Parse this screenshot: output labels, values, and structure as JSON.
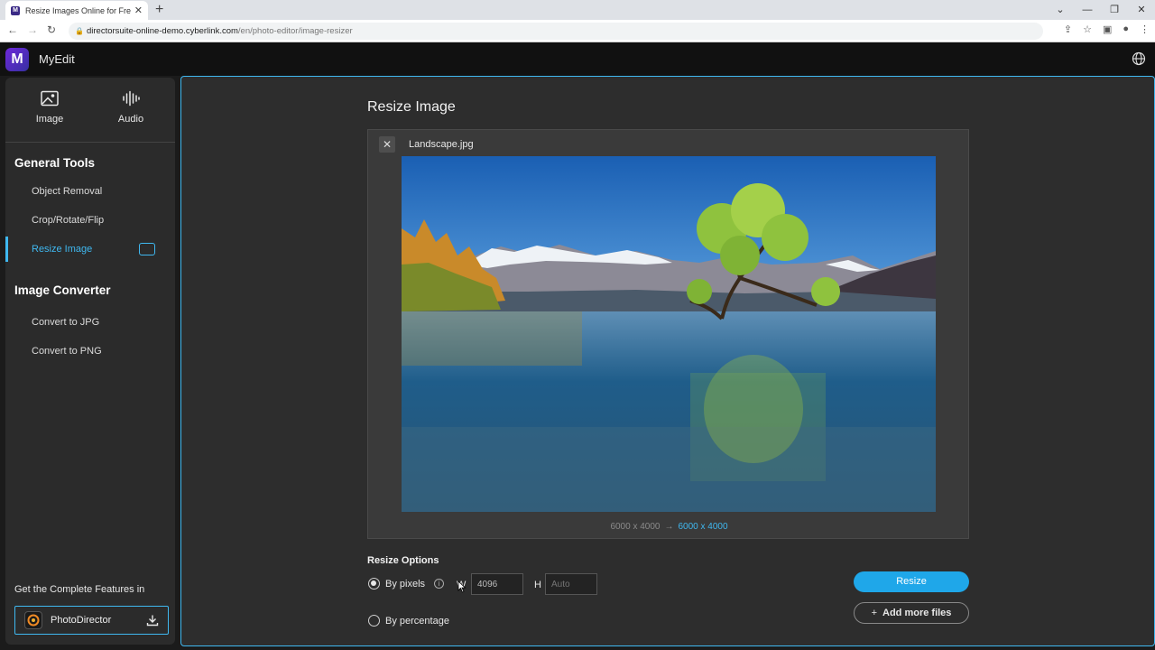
{
  "browser": {
    "tab_title": "Resize Images Online for Free - P",
    "tab_favicon_letter": "M",
    "url_host": "directorsuite-online-demo.cyberlink.com",
    "url_path": "/en/photo-editor/image-resizer"
  },
  "app": {
    "name": "MyEdit",
    "logo_letter": "M"
  },
  "sidebar": {
    "categories": [
      {
        "label": "Image",
        "icon": "image-icon"
      },
      {
        "label": "Audio",
        "icon": "audio-waveform-icon"
      }
    ],
    "sections": [
      {
        "heading": "General Tools",
        "items": [
          {
            "label": "Object Removal"
          },
          {
            "label": "Crop/Rotate/Flip"
          },
          {
            "label": "Resize Image",
            "active": true
          }
        ]
      },
      {
        "heading": "Image Converter",
        "items": [
          {
            "label": "Convert to JPG"
          },
          {
            "label": "Convert to PNG"
          }
        ]
      }
    ],
    "promo_text": "Get the Complete Features in",
    "promo_product": "PhotoDirector"
  },
  "main": {
    "title": "Resize Image",
    "file_name": "Landscape.jpg",
    "original_size": "6000 x 4000",
    "new_size": "6000 x 4000",
    "options_title": "Resize Options",
    "by_pixels_label": "By pixels",
    "by_percentage_label": "By percentage",
    "selected_option": "By pixels",
    "width_label": "W",
    "width_value": "4096",
    "height_label": "H",
    "height_placeholder": "Auto",
    "resize_button": "Resize",
    "add_files_button": "Add more files"
  },
  "colors": {
    "accent": "#3fb8f0",
    "button": "#1fa7e9",
    "panel": "#2d2d2d",
    "sidebar": "#2b2b2b"
  }
}
